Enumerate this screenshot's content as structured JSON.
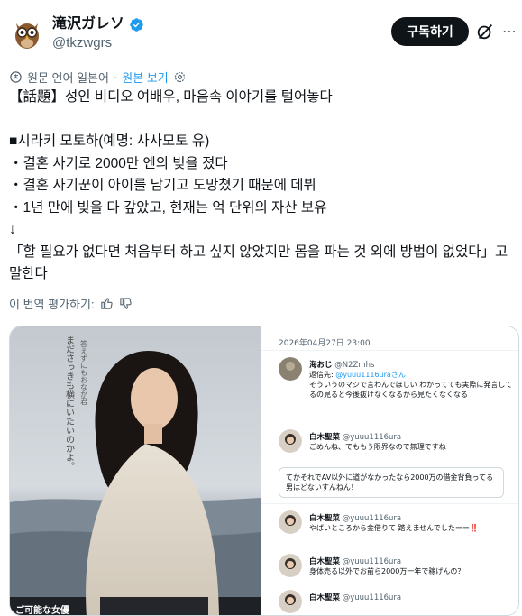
{
  "author": {
    "display_name": "滝沢ガレソ",
    "handle": "@tkzwgrs",
    "avatar_icon": "owl-avatar-icon",
    "verified_icon": "verified-badge-icon",
    "verified_color": "#1d9bf0"
  },
  "actions": {
    "subscribe_label": "구독하기",
    "grok_icon": "grok-icon",
    "more_icon": "more-dots-icon"
  },
  "translation": {
    "translated_from": "원문 언어 일본어",
    "show_original": "원본 보기",
    "rate_label": "이 번역 평가하기:"
  },
  "tweet": {
    "lines": [
      "【話題】성인 비디오 여배우, 마음속 이야기를 털어놓다",
      "",
      "■시라키 모토하(예명: 사사모토 유)",
      "・결혼 사기로 2000만 엔의 빚을 졌다",
      "・결혼 사기꾼이 아이를 남기고 도망쳤기 때문에 데뷔",
      "・1년 만에 빚을 다 갚았고, 현재는 억 단위의 자산 보유",
      "↓",
      "「할 필요가 없다면 처음부터 하고 싶지 않았지만 몸을 파는 것 외에 방법이 없었다」고 말한다"
    ]
  },
  "media": {
    "photo_caption": "まださっきも横にいたいのかよ。",
    "photo_caption_2": "答えずにもおなか君",
    "photo_bottom_text": "ご可能な女優",
    "screenshot": {
      "date": "2026年04月27日 23:00",
      "replies": [
        {
          "name": "海おじ",
          "handle": "@N2Zmhs",
          "reply_to_label": "返信先:",
          "reply_to": "@yuuu1116uraさん",
          "text": "そういうのマジで言わんでほしい わかってても実際に発言してるの見ると今後抜けなくなるから見たくなくなる"
        },
        {
          "name": "白木聖菜",
          "handle": "@yuuu1116ura",
          "text": "ごめんね、でももう限界なので無理ですね"
        },
        {
          "quote": "てかそれでAV以外に道がなかったなら2000万の借金背負ってる男はどないすんねん！"
        },
        {
          "name": "白木聖菜",
          "handle": "@yuuu1116ura",
          "text": "やばいところから金借りて 踏えませんでしたーー‼️"
        },
        {
          "name": "白木聖菜",
          "handle": "@yuuu1116ura",
          "text": "身体売る以外でお前ら2000万一年で稼げんの？"
        },
        {
          "name": "白木聖菜",
          "handle": "@yuuu1116ura",
          "text": ""
        }
      ]
    }
  }
}
